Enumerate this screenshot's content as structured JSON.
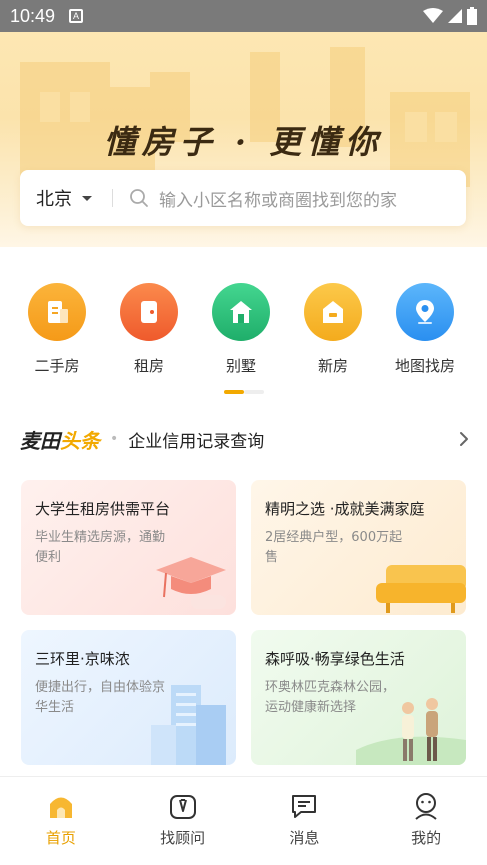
{
  "status_bar": {
    "time": "10:49",
    "notification_icon": "A"
  },
  "hero": {
    "slogan": "懂房子 · 更懂你",
    "city": "北京",
    "search_placeholder": "输入小区名称或商圈找到您的家"
  },
  "categories": [
    {
      "label": "二手房",
      "icon": "building-icon",
      "color": "#f5a623"
    },
    {
      "label": "租房",
      "icon": "door-icon",
      "color": "#f26a3c"
    },
    {
      "label": "别墅",
      "icon": "villa-icon",
      "color": "#2bc27c"
    },
    {
      "label": "新房",
      "icon": "house-icon",
      "color": "#f7b731"
    },
    {
      "label": "地图找房",
      "icon": "map-pin-icon",
      "color": "#3da1f5"
    }
  ],
  "headline": {
    "brand_a": "麦田",
    "brand_b": "头条",
    "text": "企业信用记录查询"
  },
  "cards": [
    {
      "title": "大学生租房供需平台",
      "subtitle": "毕业生精选房源，通勤便利"
    },
    {
      "title": "精明之选 ·成就美满家庭",
      "subtitle": "2居经典户型，600万起售"
    },
    {
      "title": "三环里·京味浓",
      "subtitle": "便捷出行，自由体验京华生活"
    },
    {
      "title": "森呼吸·畅享绿色生活",
      "subtitle": "环奥林匹克森林公园，运动健康新选择"
    }
  ],
  "tabbar": [
    {
      "label": "首页",
      "icon": "home-icon",
      "active": true
    },
    {
      "label": "找顾问",
      "icon": "advisor-icon",
      "active": false
    },
    {
      "label": "消息",
      "icon": "message-icon",
      "active": false
    },
    {
      "label": "我的",
      "icon": "profile-icon",
      "active": false
    }
  ],
  "colors": {
    "accent": "#f2a900",
    "hero_bg": "#fde7b3"
  }
}
